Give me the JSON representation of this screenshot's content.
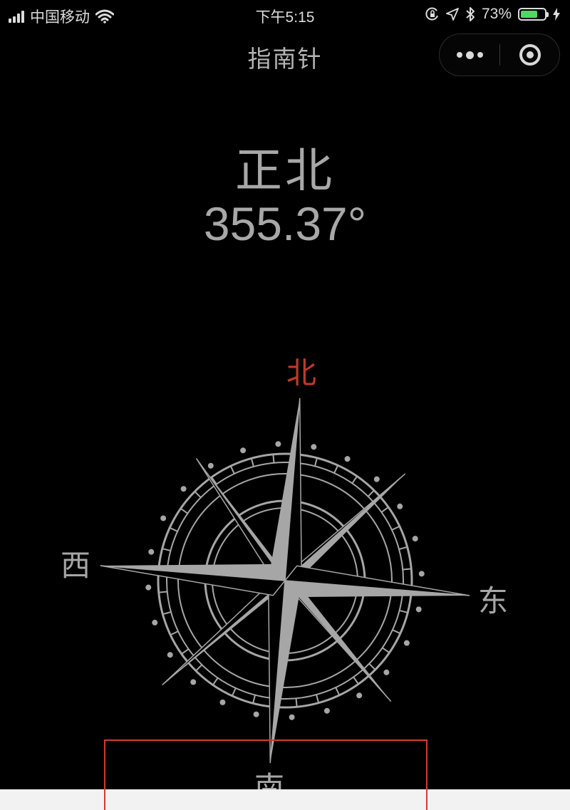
{
  "status_bar": {
    "carrier": "中国移动",
    "time": "下午5:15",
    "battery_percent": "73%",
    "battery_level": 0.73,
    "icons": [
      "signal-icon",
      "wifi-icon",
      "orientation-lock-icon",
      "location-icon",
      "bluetooth-icon",
      "battery-icon",
      "charging-icon"
    ]
  },
  "nav": {
    "title": "指南针",
    "more_icon": "more-dots-icon",
    "close_icon": "close-target-icon"
  },
  "heading": {
    "direction": "正北",
    "degrees": "355.37°"
  },
  "compass": {
    "labels": {
      "north": "北",
      "south": "南",
      "east": "东",
      "west": "西"
    },
    "north_color": "#c0392b",
    "rose_color": "#a6a6a6",
    "rotation_degrees": 4.63
  },
  "colors": {
    "background": "#000000",
    "highlight": "#d43a30",
    "battery_fill": "#4cd964"
  }
}
